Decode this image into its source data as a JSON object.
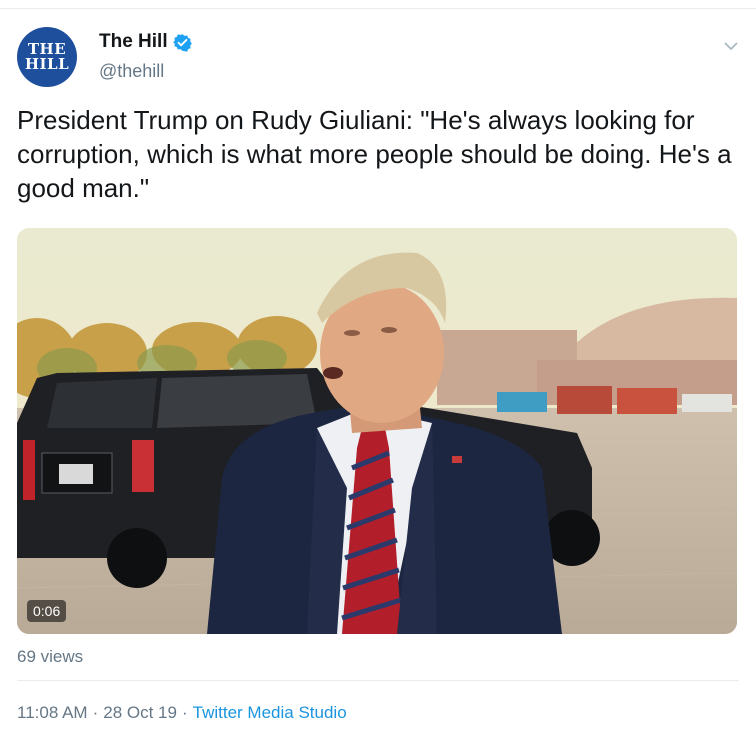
{
  "account": {
    "avatar_text_line1": "THE",
    "avatar_text_line2": "HILL",
    "display_name": "The Hill",
    "handle": "@thehill"
  },
  "icons": {
    "verified": "verified-badge-icon",
    "menu": "chevron-down-icon"
  },
  "tweet": {
    "text": "President Trump on Rudy Giuliani: \"He's always looking for corruption, which is what more people should be doing. He's a good man.\""
  },
  "media": {
    "type": "video",
    "duration": "0:06"
  },
  "stats": {
    "views": "69 views"
  },
  "meta": {
    "time": "11:08 AM",
    "separator": "·",
    "date": "28 Oct 19",
    "source": "Twitter Media Studio"
  },
  "colors": {
    "link": "#1b95e0",
    "secondary_text": "#657786",
    "verified": "#1da1f2",
    "avatar_bg": "#1d4f9c"
  }
}
